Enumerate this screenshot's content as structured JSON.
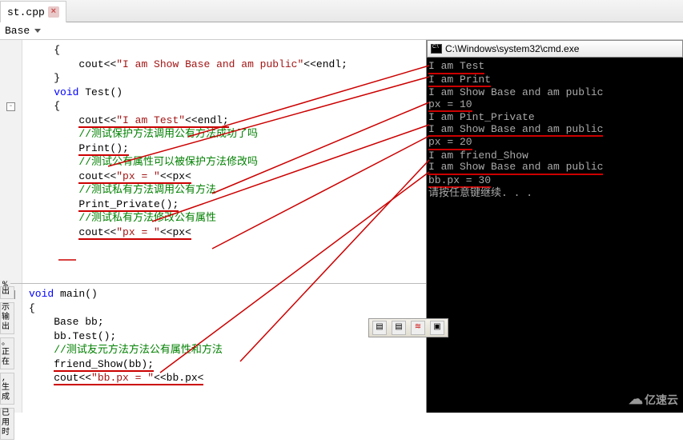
{
  "tab": {
    "filename": "st.cpp",
    "close": "×"
  },
  "dropdown": {
    "class": "Base"
  },
  "percent_label": "%",
  "code_top": {
    "lines": [
      {
        "indent": 2,
        "text": "{"
      },
      {
        "indent": 4,
        "cout": "cout",
        "sh1": "<<",
        "str": "\"I am Show Base and am public\"",
        "sh2": "<<",
        "endl": "endl;"
      },
      {
        "indent": 2,
        "text": "}"
      },
      {
        "indent": 0,
        "text": ""
      },
      {
        "indent": 2,
        "kw": "void",
        "fn": " Test()"
      },
      {
        "indent": 2,
        "text": "{"
      },
      {
        "indent": 4,
        "cout": "cout",
        "sh1": "<<",
        "str": "\"I am Test\"",
        "sh2": "<<",
        "endl": "endl;",
        "ul": true
      },
      {
        "indent": 4,
        "cmt": "//测试保护方法调用公有方法成功了吗"
      },
      {
        "indent": 4,
        "text": "Print();",
        "ul": true
      },
      {
        "indent": 4,
        "cmt": "//测试公有属性可以被保护方法修改吗"
      },
      {
        "indent": 4,
        "cout": "cout",
        "sh1": "<<",
        "str": "\"px = \"",
        "sh2": "<<",
        "rest": "px<<endl;",
        "ul": true
      },
      {
        "indent": 4,
        "cmt": "//测试私有方法调用公有方法"
      },
      {
        "indent": 4,
        "text": "Print_Private();",
        "ul": true
      },
      {
        "indent": 4,
        "cmt": "//测试私有方法修改公有属性"
      },
      {
        "indent": 4,
        "cout": "cout",
        "sh1": "<<",
        "str": "\"px = \"",
        "sh2": "<<",
        "rest": "px<<endl;",
        "ul": true
      }
    ]
  },
  "code_bottom": {
    "lines": [
      {
        "indent": 0,
        "kw": "void",
        "fn": " main()"
      },
      {
        "indent": 0,
        "text": "{"
      },
      {
        "indent": 2,
        "text": "Base bb;"
      },
      {
        "indent": 2,
        "text": "bb.Test();"
      },
      {
        "indent": 0,
        "text": ""
      },
      {
        "indent": 2,
        "cmt": "//测试友元方法方法公有属性和方法"
      },
      {
        "indent": 2,
        "text": "friend_Show(bb);",
        "ul": true
      },
      {
        "indent": 2,
        "cout": "cout",
        "sh1": "<<",
        "str": "\"bb.px = \"",
        "sh2": "<<",
        "rest": "bb.px<<endl;",
        "ul": true
      }
    ]
  },
  "sidebar_labels": [
    "出",
    "示输出",
    "。正在",
    ",生成",
    "已用时"
  ],
  "console": {
    "title": "C:\\Windows\\system32\\cmd.exe",
    "lines": [
      {
        "t": "I am Test",
        "ul": true
      },
      {
        "t": "I am Print",
        "ul": true
      },
      {
        "t": "I am Show Base and am public"
      },
      {
        "t": "px = 10",
        "ul": true
      },
      {
        "t": "I am Pint_Private"
      },
      {
        "t": "I am Show Base and am public",
        "ul": true
      },
      {
        "t": "px = 20",
        "ul": true
      },
      {
        "t": "I am friend_Show"
      },
      {
        "t": "I am Show Base and am public",
        "ul": true
      },
      {
        "t": "bb.px = 30",
        "ul": true
      },
      {
        "t": "请按任意键继续. . ."
      }
    ]
  },
  "watermark": {
    "text": "亿速云"
  }
}
